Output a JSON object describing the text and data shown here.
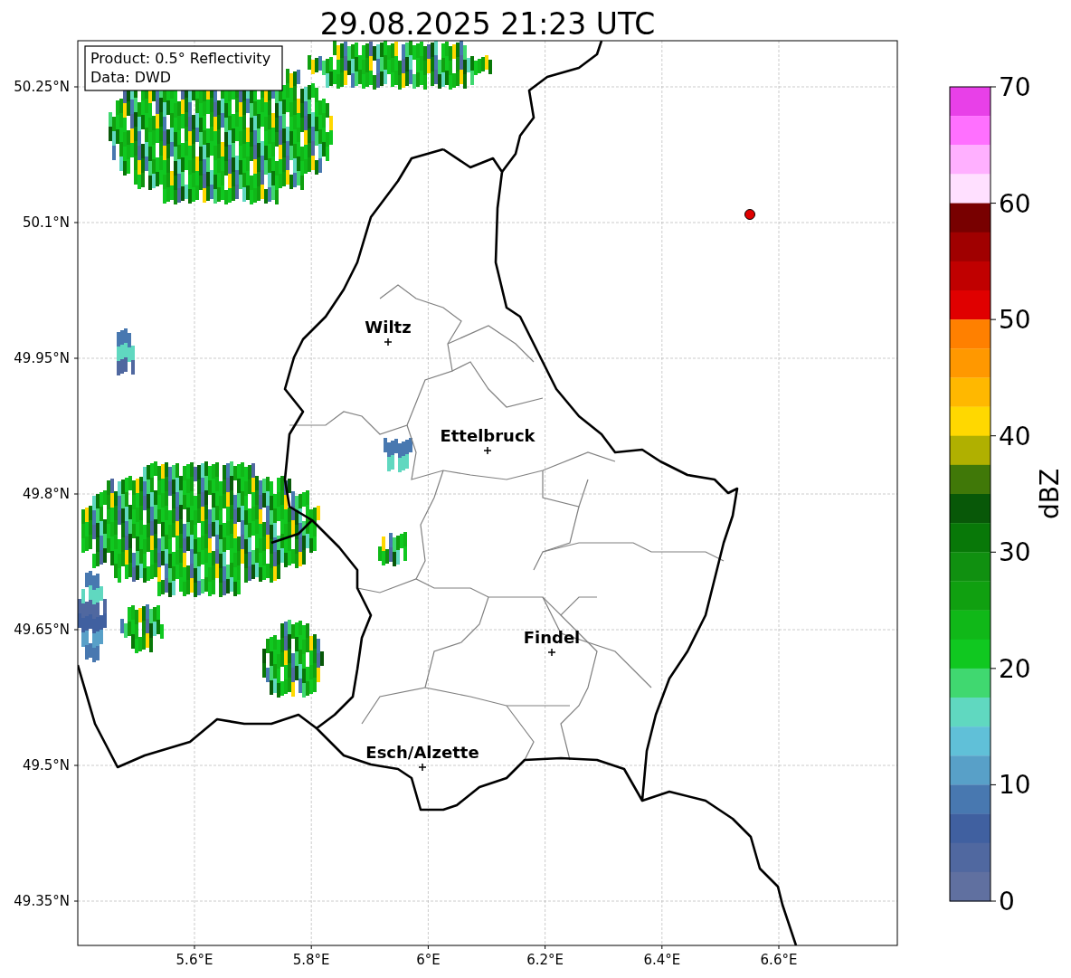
{
  "title": "29.08.2025 21:23 UTC",
  "info_box": [
    "Product: 0.5° Reflectivity",
    "Data: DWD"
  ],
  "lat_ticks": [
    "50.25°N",
    "50.1°N",
    "49.95°N",
    "49.8°N",
    "49.65°N",
    "49.5°N",
    "49.35°N"
  ],
  "lon_ticks": [
    "5.6°E",
    "5.8°E",
    "6°E",
    "6.2°E",
    "6.4°E",
    "6.6°E"
  ],
  "cities": [
    "Wiltz",
    "Ettelbruck",
    "Findel",
    "Esch/Alzette"
  ],
  "colorbar": {
    "label": "dBZ",
    "ticks": [
      "70",
      "60",
      "50",
      "40",
      "30",
      "20",
      "10",
      "0"
    ],
    "bins": [
      {
        "color": "#e840e8"
      },
      {
        "color": "#ff70ff"
      },
      {
        "color": "#ffb0ff"
      },
      {
        "color": "#ffe0ff"
      },
      {
        "color": "#780000"
      },
      {
        "color": "#a00000"
      },
      {
        "color": "#c00000"
      },
      {
        "color": "#e00000"
      },
      {
        "color": "#ff8000"
      },
      {
        "color": "#ff9800"
      },
      {
        "color": "#ffb800"
      },
      {
        "color": "#ffd800"
      },
      {
        "color": "#b0b000"
      },
      {
        "color": "#407808"
      },
      {
        "color": "#085808"
      },
      {
        "color": "#087808"
      },
      {
        "color": "#109010"
      },
      {
        "color": "#10a010"
      },
      {
        "color": "#10b818"
      },
      {
        "color": "#10c820"
      },
      {
        "color": "#40d870"
      },
      {
        "color": "#60d8c0"
      },
      {
        "color": "#60c0d8"
      },
      {
        "color": "#58a0c8"
      },
      {
        "color": "#4878b0"
      },
      {
        "color": "#4060a0"
      },
      {
        "color": "#5068a0"
      },
      {
        "color": "#6070a0"
      }
    ]
  }
}
